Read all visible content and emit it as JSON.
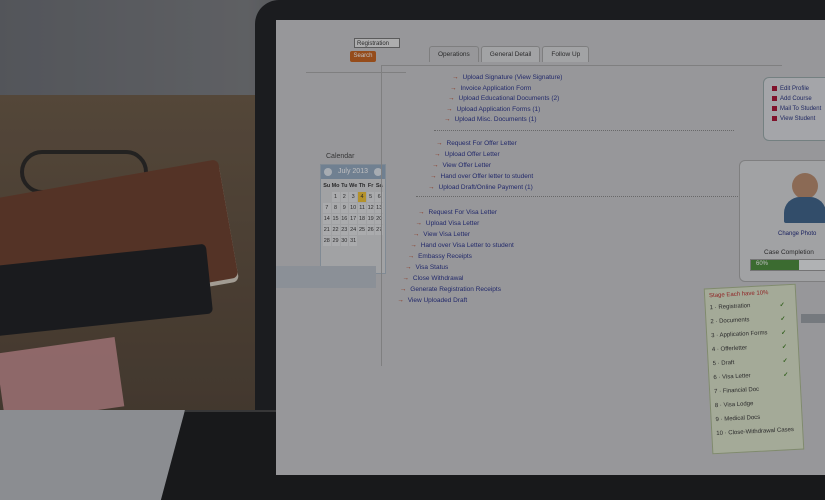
{
  "left": {
    "dropdown_value": "Registration",
    "search_label": "Search",
    "calendar": {
      "title": "Calendar",
      "month": "July 2013",
      "days_header": [
        "Su",
        "Mo",
        "Tu",
        "We",
        "Th",
        "Fr",
        "Sa"
      ],
      "rows": [
        [
          "",
          "1",
          "2",
          "3",
          "4",
          "5",
          "6"
        ],
        [
          "7",
          "8",
          "9",
          "10",
          "11",
          "12",
          "13"
        ],
        [
          "14",
          "15",
          "16",
          "17",
          "18",
          "19",
          "20"
        ],
        [
          "21",
          "22",
          "23",
          "24",
          "25",
          "26",
          "27"
        ],
        [
          "28",
          "29",
          "30",
          "31",
          "",
          "",
          ""
        ]
      ],
      "today": "4"
    }
  },
  "tabs": [
    {
      "label": "Operations"
    },
    {
      "label": "General Detail"
    },
    {
      "label": "Follow Up"
    }
  ],
  "links": {
    "group1": [
      "Upload Signature   (View Signature)",
      "Invoice Application Form",
      "Upload Educational Documents (2)",
      "Upload Application Forms (1)",
      "Upload Misc. Documents (1)"
    ],
    "group2": [
      "Request For Offer Letter",
      "Upload Offer Letter",
      "View Offer Letter",
      "Hand over Offer letter to student",
      "Upload Draft/Online Payment (1)"
    ],
    "group3": [
      "Request For Visa Letter",
      "Upload Visa Letter",
      "View Visa Letter",
      "Hand over Visa Letter to student",
      "Embassy Receipts",
      "Visa Status",
      "Close Withdrawal",
      "Generate Registration Receipts",
      "View Uploaded Draft"
    ]
  },
  "quick_links": [
    "Edit Profile",
    "Add Course",
    "Mail To Student",
    "View Student"
  ],
  "profile": {
    "change_photo": "Change Photo",
    "case_completion_label": "Case Completion",
    "progress_text": "60%",
    "progress_value": 60
  },
  "stages": {
    "title": "Stage Each have 10%",
    "items": [
      "1 · Registration",
      "2 · Documents",
      "3 · Application Forms",
      "4 · Offerletter",
      "5 · Draft",
      "6 · Visa Letter",
      "7 · Financial Doc",
      "8 · Visa Lodge",
      "9 · Medical Docs",
      "10 · Close-Withdrawal Cases"
    ]
  },
  "colors": {
    "search_button": "#c7621d",
    "link": "#27308a",
    "arrow": "#b53a1a",
    "progress": "#4a8d3a",
    "stage_title": "#bf2b2b"
  }
}
